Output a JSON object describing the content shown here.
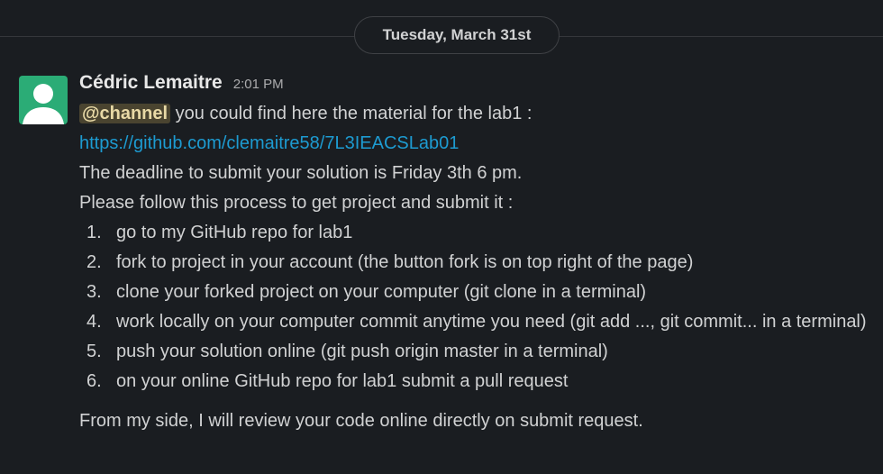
{
  "date_divider": {
    "label": "Tuesday, March 31st"
  },
  "message": {
    "author": "Cédric Lemaitre",
    "time": "2:01 PM",
    "mention": "@channel",
    "intro_text": " you could find here the material for the lab1 :",
    "link": "https://github.com/clemaitre58/7L3IEACSLab01",
    "deadline": "The deadline to submit your solution is Friday 3th 6 pm.",
    "process_intro": "Please follow this process to get project and submit it :",
    "steps": [
      {
        "num": "1.",
        "text": "go to my GitHub repo for lab1"
      },
      {
        "num": "2.",
        "text": "fork to project in your account (the button fork is on top right of the page)"
      },
      {
        "num": "3.",
        "text": "clone your forked project on your computer (git clone in a terminal)"
      },
      {
        "num": "4.",
        "text": "work locally on your computer commit anytime you need (git add ..., git commit... in a terminal)"
      },
      {
        "num": "5.",
        "text": "push your solution online (git push origin master in a terminal)"
      },
      {
        "num": "6.",
        "text": "on your online GitHub repo for lab1 submit a pull request"
      }
    ],
    "closing": "From my side, I will review your code online directly on submit request."
  },
  "colors": {
    "background": "#1a1d21",
    "avatar": "#2bac76",
    "link": "#1d9bd1",
    "mention_bg": "#4a4430"
  }
}
